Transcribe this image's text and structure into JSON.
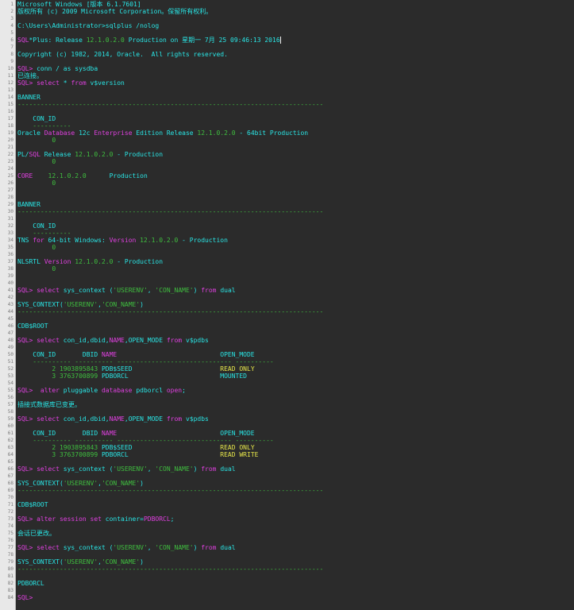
{
  "colors": {
    "background": "#2b2b2b",
    "gutter": "#e8e8e8",
    "text": "#f0f0f0",
    "cyan": "#29e6e6",
    "yellow": "#e6e64a",
    "magenta": "#e040e0",
    "green": "#3fbf3f",
    "red": "#ff3b3b"
  },
  "lines": [
    [
      [
        "c",
        "Microsoft Windows [版本 6.1.7601]"
      ]
    ],
    [
      [
        "c",
        "版权所有 (c) 2009 Microsoft Corporation。保留所有权利。"
      ]
    ],
    [
      [
        "w",
        ""
      ]
    ],
    [
      [
        "c",
        "C:\\Users\\Administrator>sqlplus /nolog"
      ]
    ],
    [
      [
        "w",
        ""
      ]
    ],
    [
      [
        "m",
        "SQL"
      ],
      [
        "c",
        "*Plus: Release "
      ],
      [
        "g",
        "12.1.0.2.0"
      ],
      [
        "c",
        " Production on 星期一 7月 25 09:46:13 2016"
      ]
    ],
    [
      [
        "w",
        ""
      ]
    ],
    [
      [
        "c",
        "Copyright (c) 1982, 2014, Oracle.  All rights reserved."
      ]
    ],
    [
      [
        "w",
        ""
      ]
    ],
    [
      [
        "m",
        "SQL>"
      ],
      [
        "c",
        " conn / as sysdba"
      ]
    ],
    [
      [
        "c",
        "已连接。"
      ]
    ],
    [
      [
        "m",
        "SQL> select"
      ],
      [
        "c",
        " * "
      ],
      [
        "m",
        "from"
      ],
      [
        "c",
        " v$version"
      ]
    ],
    [
      [
        "w",
        ""
      ]
    ],
    [
      [
        "c",
        "BANNER"
      ]
    ],
    [
      [
        "sep",
        "--------------------------------------------------------------------------------"
      ]
    ],
    [
      [
        "w",
        ""
      ]
    ],
    [
      [
        "c",
        "    CON_ID"
      ]
    ],
    [
      [
        "sep",
        "    ----------"
      ]
    ],
    [
      [
        "c",
        "Oracle "
      ],
      [
        "m",
        "Database"
      ],
      [
        "c",
        " 12c "
      ],
      [
        "m",
        "Enterprise"
      ],
      [
        "c",
        " Edition Release "
      ],
      [
        "g",
        "12.1.0.2.0"
      ],
      [
        "c",
        " - 64bit Production"
      ]
    ],
    [
      [
        "g",
        "         0"
      ]
    ],
    [
      [
        "w",
        ""
      ]
    ],
    [
      [
        "c",
        "PL/"
      ],
      [
        "m",
        "SQL"
      ],
      [
        "c",
        " Release "
      ],
      [
        "g",
        "12.1.0.2.0"
      ],
      [
        "c",
        " - Production"
      ]
    ],
    [
      [
        "g",
        "         0"
      ]
    ],
    [
      [
        "w",
        ""
      ]
    ],
    [
      [
        "m",
        "CORE"
      ],
      [
        "c",
        "    "
      ],
      [
        "g",
        "12.1.0.2.0"
      ],
      [
        "c",
        "      Production"
      ]
    ],
    [
      [
        "g",
        "         0"
      ]
    ],
    [
      [
        "w",
        ""
      ]
    ],
    [
      [
        "w",
        ""
      ]
    ],
    [
      [
        "c",
        "BANNER"
      ]
    ],
    [
      [
        "sep",
        "--------------------------------------------------------------------------------"
      ]
    ],
    [
      [
        "w",
        ""
      ]
    ],
    [
      [
        "c",
        "    CON_ID"
      ]
    ],
    [
      [
        "sep",
        "    ----------"
      ]
    ],
    [
      [
        "c",
        "TNS "
      ],
      [
        "m",
        "for"
      ],
      [
        "c",
        " 64-bit Windows: "
      ],
      [
        "m",
        "Version"
      ],
      [
        "c",
        " "
      ],
      [
        "g",
        "12.1.0.2.0"
      ],
      [
        "c",
        " - Production"
      ]
    ],
    [
      [
        "g",
        "         0"
      ]
    ],
    [
      [
        "w",
        ""
      ]
    ],
    [
      [
        "c",
        "NLSRTL "
      ],
      [
        "m",
        "Version"
      ],
      [
        "c",
        " "
      ],
      [
        "g",
        "12.1.0.2.0"
      ],
      [
        "c",
        " - Production"
      ]
    ],
    [
      [
        "g",
        "         0"
      ]
    ],
    [
      [
        "w",
        ""
      ]
    ],
    [
      [
        "w",
        ""
      ]
    ],
    [
      [
        "m",
        "SQL> select"
      ],
      [
        "c",
        " sys_context ("
      ],
      [
        "g",
        "'USERENV'"
      ],
      [
        "c",
        ", "
      ],
      [
        "g",
        "'CON_NAME'"
      ],
      [
        "c",
        ") "
      ],
      [
        "m",
        "from"
      ],
      [
        "c",
        " dual"
      ]
    ],
    [
      [
        "w",
        ""
      ]
    ],
    [
      [
        "c",
        "SYS_CONTEXT("
      ],
      [
        "g",
        "'USERENV'"
      ],
      [
        "c",
        ","
      ],
      [
        "g",
        "'CON_NAME'"
      ],
      [
        "c",
        ")"
      ]
    ],
    [
      [
        "sep",
        "--------------------------------------------------------------------------------"
      ]
    ],
    [
      [
        "w",
        ""
      ]
    ],
    [
      [
        "c",
        "CDB$ROOT"
      ]
    ],
    [
      [
        "w",
        ""
      ]
    ],
    [
      [
        "m",
        "SQL> select"
      ],
      [
        "c",
        " con_id,dbid,"
      ],
      [
        "m",
        "NAME"
      ],
      [
        "c",
        ",OPEN_MODE "
      ],
      [
        "m",
        "from"
      ],
      [
        "c",
        " v$pdbs"
      ]
    ],
    [
      [
        "w",
        ""
      ]
    ],
    [
      [
        "c",
        "    CON_ID       DBID "
      ],
      [
        "m",
        "NAME"
      ],
      [
        "c",
        "                           OPEN_MODE"
      ]
    ],
    [
      [
        "sep",
        "    ---------- ---------- ------------------------------ ----------"
      ]
    ],
    [
      [
        "g",
        "         2 1903895843"
      ],
      [
        "c",
        " PDB$SEED                       "
      ],
      [
        "y",
        "READ ONLY"
      ]
    ],
    [
      [
        "g",
        "         3 3763700899"
      ],
      [
        "c",
        " PDBORCL                        MOUNTED"
      ]
    ],
    [
      [
        "w",
        ""
      ]
    ],
    [
      [
        "m",
        "SQL>  alter"
      ],
      [
        "c",
        " pluggable "
      ],
      [
        "m",
        "database"
      ],
      [
        "c",
        " pdborcl "
      ],
      [
        "m",
        "open"
      ],
      [
        "c",
        ";"
      ]
    ],
    [
      [
        "w",
        ""
      ]
    ],
    [
      [
        "c",
        "插接式数据库已变更。"
      ]
    ],
    [
      [
        "w",
        ""
      ]
    ],
    [
      [
        "m",
        "SQL> select"
      ],
      [
        "c",
        " con_id,dbid,"
      ],
      [
        "m",
        "NAME"
      ],
      [
        "c",
        ",OPEN_MODE "
      ],
      [
        "m",
        "from"
      ],
      [
        "c",
        " v$pdbs"
      ]
    ],
    [
      [
        "w",
        ""
      ]
    ],
    [
      [
        "c",
        "    CON_ID       DBID "
      ],
      [
        "m",
        "NAME"
      ],
      [
        "c",
        "                           OPEN_MODE"
      ]
    ],
    [
      [
        "sep",
        "    ---------- ---------- ------------------------------ ----------"
      ]
    ],
    [
      [
        "g",
        "         2 1903895843"
      ],
      [
        "c",
        " PDB$SEED                       "
      ],
      [
        "y",
        "READ ONLY"
      ]
    ],
    [
      [
        "g",
        "         3 3763700899"
      ],
      [
        "c",
        " PDBORCL                        "
      ],
      [
        "y",
        "READ WRITE"
      ]
    ],
    [
      [
        "w",
        ""
      ]
    ],
    [
      [
        "m",
        "SQL> select"
      ],
      [
        "c",
        " sys_context ("
      ],
      [
        "g",
        "'USERENV'"
      ],
      [
        "c",
        ", "
      ],
      [
        "g",
        "'CON_NAME'"
      ],
      [
        "c",
        ") "
      ],
      [
        "m",
        "from"
      ],
      [
        "c",
        " dual"
      ]
    ],
    [
      [
        "w",
        ""
      ]
    ],
    [
      [
        "c",
        "SYS_CONTEXT("
      ],
      [
        "g",
        "'USERENV'"
      ],
      [
        "c",
        ","
      ],
      [
        "g",
        "'CON_NAME'"
      ],
      [
        "c",
        ")"
      ]
    ],
    [
      [
        "sep",
        "--------------------------------------------------------------------------------"
      ]
    ],
    [
      [
        "w",
        ""
      ]
    ],
    [
      [
        "c",
        "CDB$ROOT"
      ]
    ],
    [
      [
        "w",
        ""
      ]
    ],
    [
      [
        "m",
        "SQL> alter session set"
      ],
      [
        "c",
        " container="
      ],
      [
        "m",
        "PDBORCL"
      ],
      [
        "c",
        ";"
      ]
    ],
    [
      [
        "w",
        ""
      ]
    ],
    [
      [
        "c",
        "会话已更改。"
      ]
    ],
    [
      [
        "w",
        ""
      ]
    ],
    [
      [
        "m",
        "SQL> select"
      ],
      [
        "c",
        " sys_context ("
      ],
      [
        "g",
        "'USERENV'"
      ],
      [
        "c",
        ", "
      ],
      [
        "g",
        "'CON_NAME'"
      ],
      [
        "c",
        ") "
      ],
      [
        "m",
        "from"
      ],
      [
        "c",
        " dual"
      ]
    ],
    [
      [
        "w",
        ""
      ]
    ],
    [
      [
        "c",
        "SYS_CONTEXT("
      ],
      [
        "g",
        "'USERENV'"
      ],
      [
        "c",
        ","
      ],
      [
        "g",
        "'CON_NAME'"
      ],
      [
        "c",
        ")"
      ]
    ],
    [
      [
        "sep",
        "--------------------------------------------------------------------------------"
      ]
    ],
    [
      [
        "w",
        ""
      ]
    ],
    [
      [
        "c",
        "PDBORCL"
      ]
    ],
    [
      [
        "w",
        ""
      ]
    ],
    [
      [
        "m",
        "SQL>"
      ]
    ]
  ]
}
